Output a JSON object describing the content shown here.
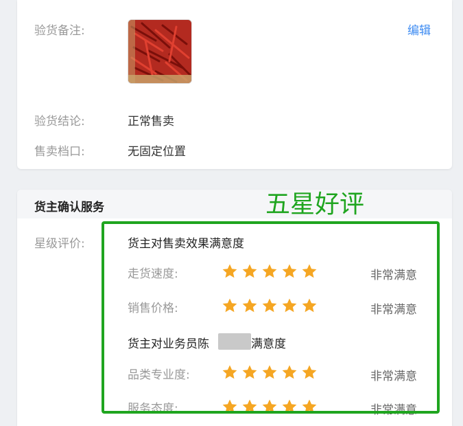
{
  "inspection": {
    "remark_label": "验货备注:",
    "edit_label": "编辑",
    "conclusion_label": "验货结论:",
    "conclusion_value": "正常售卖",
    "stall_label": "售卖档口:",
    "stall_value": "无固定位置"
  },
  "service": {
    "section_title": "货主确认服务",
    "annotation": "五星好评",
    "star_label": "星级评价:",
    "sales_group_title": "货主对售卖效果满意度",
    "staff_title_prefix": "货主对业务员陈",
    "staff_title_suffix": "满意度",
    "star_color": "#f5a623",
    "ratings": [
      {
        "label": "走货速度:",
        "stars": 5,
        "text": "非常满意"
      },
      {
        "label": "销售价格:",
        "stars": 5,
        "text": "非常满意"
      },
      {
        "label": "品类专业度:",
        "stars": 5,
        "text": "非常满意"
      },
      {
        "label": "服务态度:",
        "stars": 5,
        "text": "非常满意"
      }
    ]
  }
}
